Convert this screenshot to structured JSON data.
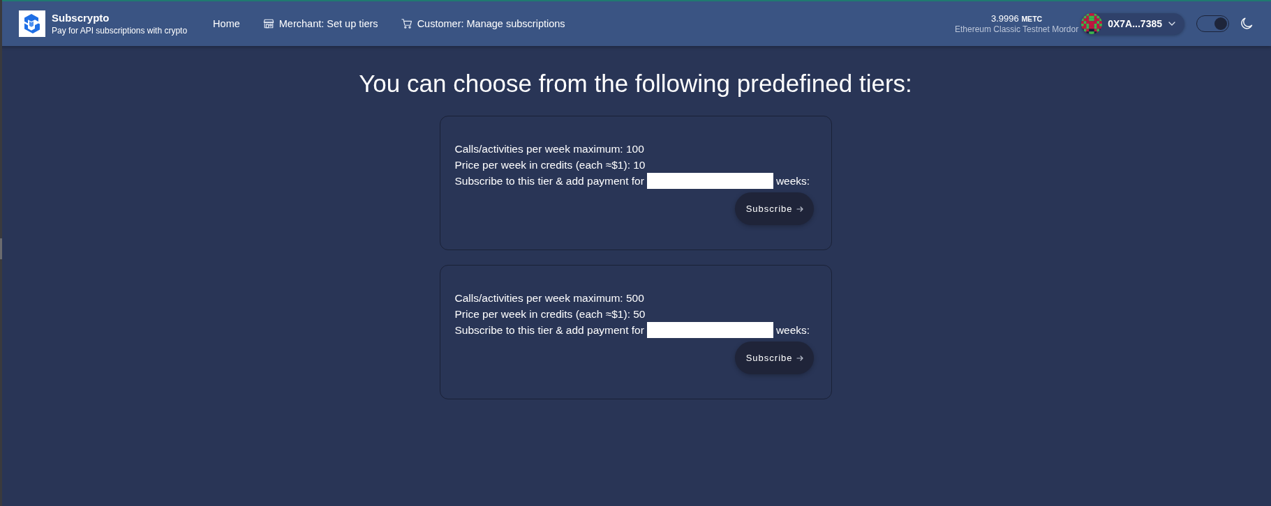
{
  "header": {
    "brand": {
      "title": "Subscrypto",
      "subtitle": "Pay for API subscriptions with crypto"
    },
    "nav": [
      {
        "label": "Home",
        "kind": "plain"
      },
      {
        "label": "Merchant: Set up tiers",
        "kind": "store"
      },
      {
        "label": "Customer: Manage subscriptions",
        "kind": "cart"
      }
    ],
    "balance": {
      "amount": "3.9996",
      "unit": "METC",
      "network": "Ethereum Classic Testnet Mordor"
    },
    "account": {
      "address": "0X7A...7385"
    },
    "theme_toggle": {
      "on": true
    }
  },
  "heading": "You can choose from the following predefined tiers:",
  "tiers": [
    {
      "limit": "Calls/activities per week maximum: 100",
      "price": "Price per week in credits (each ≈$1): 10",
      "weeks_prefix": "Subscribe to this tier & add payment for",
      "weeks_suffix": "weeks:",
      "button": "Subscribe"
    },
    {
      "limit": "Calls/activities per week maximum: 500",
      "price": "Price per week in credits (each ≈$1): 50",
      "weeks_prefix": "Subscribe to this tier & add payment for",
      "weeks_suffix": "weeks:",
      "button": "Subscribe"
    }
  ]
}
